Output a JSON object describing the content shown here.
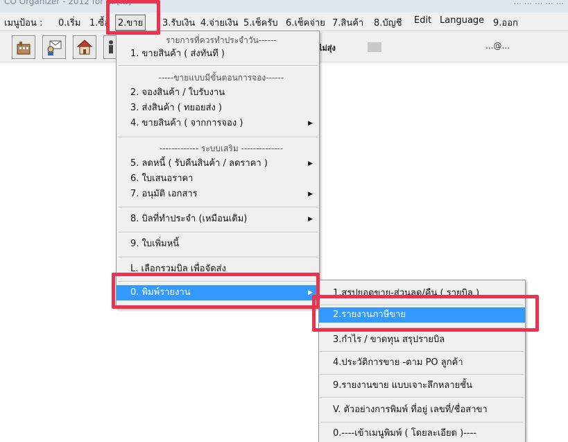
{
  "titlebar": {
    "left": "CO Organizer - 2012 for ... [...]",
    "right": "... ... ... ... ..."
  },
  "menubar": {
    "items": [
      "เมนูป้อน :",
      "0.เริ่ม",
      "1.ซื้อ",
      "2.ขาย",
      "3.รับเงิน",
      "4.จ่ายเงิน",
      "5.เช็ครับ",
      "6.เช็คจ่าย",
      "7.สินค้า",
      "8.บัญชี",
      "Edit",
      "Language",
      "9.ออก"
    ]
  },
  "toolbar": {
    "status_text": "ไม่สุ่ง",
    "email": "...@..."
  },
  "menu": {
    "header1": "รายการที่ควรทำประจำวัน------",
    "item1": "1. ขายสินค้า ( ส่งทันที )",
    "header2": "-----ขายแบบมีขั้นตอนการจอง------",
    "item2": "2. จองสินค้า / ใบรับงาน",
    "item3": "3. ส่งสินค้า  ( ทยอยส่ง )",
    "item4": "4. ขายสินค้า ( จากการจอง )",
    "header3": "------------- ระบบเสริม --------------",
    "item5": "5. ลดหนี้  ( รับคืนสินค้า / ลดราคา )",
    "item6": "6. ใบเสนอราคา",
    "item7": "7. อนุมัติ เอกสาร",
    "item8": "8. บิลที่ทำประจำ (เหมือนเดิม)",
    "item9": "9. ใบเพิ่มหนี้",
    "itemL": "L. เลือกรวมบิล เพื่อจัดส่ง",
    "item0": "0. พิมพ์รายงาน"
  },
  "submenu": {
    "s1": "1.สรุปยอดขาย-ส่วนลด/คืน ( รายบิล )",
    "s2": "2.รายงานภาษีขาย",
    "s3": "3.กำไร / ขาดทุน สรุปรายบิล",
    "s4": "4.ประวัติการขาย -ตาม PO ลูกค้า",
    "s9": "9.รายงานขาย แบบเจาะลึกหลายชั้น",
    "sV": "V. ตัวอย่างการพิมพ์  ที่อยู่ เลขที่/ชื่อสาขา",
    "s0": "0.----เข้าเมนูพิมพ์  ( โดยละเอียด )----"
  },
  "arrow_glyph": "▶",
  "colors": {
    "highlight": "#3399ff",
    "annotation": "#e8344f",
    "menu_bg": "#f0f0f0"
  }
}
